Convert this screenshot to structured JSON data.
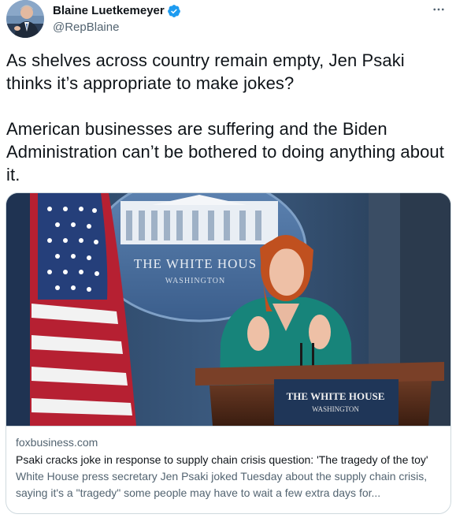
{
  "author": {
    "display_name": "Blaine Luetkemeyer",
    "handle": "@RepBlaine",
    "verified": true
  },
  "tweet": {
    "text": "As shelves across country remain empty, Jen Psaki thinks it’s appropriate to make jokes?\n\nAmerican businesses are suffering and the Biden Administration can’t be bothered to doing anything about it."
  },
  "card": {
    "domain": "foxbusiness.com",
    "title": "Psaki cracks joke in response to supply chain crisis question: 'The tragedy of the toy'",
    "description": "White House press secretary Jen Psaki joked Tuesday about the supply chain crisis, saying it's a \"tragedy\" some people may have to wait a few extra days for...",
    "image": {
      "seal_text": "THE WHITE HOUS",
      "seal_subtext": "WASHINGTON",
      "podium_text": "THE WHITE HOUSE",
      "podium_subtext": "WASHINGTON"
    }
  },
  "icons": {
    "verified": "verified-badge-icon",
    "more": "more-horizontal-icon"
  },
  "colors": {
    "text_primary": "#0f1419",
    "text_secondary": "#536471",
    "verified_blue": "#1d9bf0",
    "border": "#cfd9de"
  }
}
